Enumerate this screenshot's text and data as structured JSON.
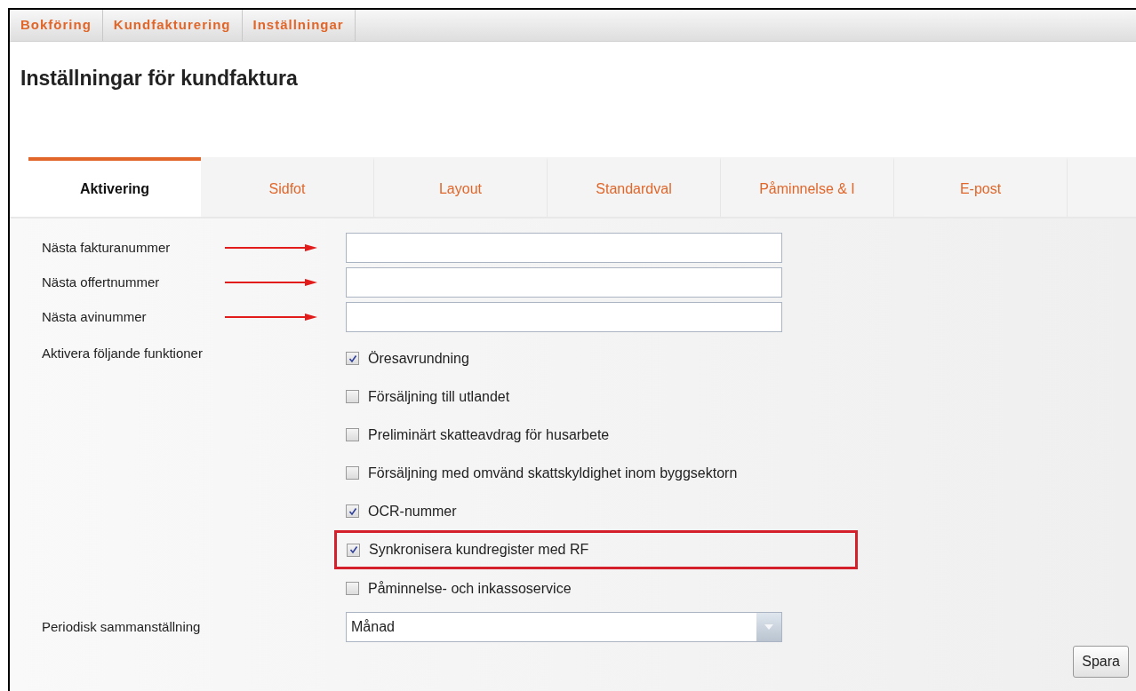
{
  "breadcrumbs": [
    "Bokföring",
    "Kundfakturering",
    "Inställningar"
  ],
  "title": "Inställningar för kundfaktura",
  "tabs": [
    {
      "label": "Aktivering",
      "selected": true
    },
    {
      "label": "Sidfot",
      "selected": false
    },
    {
      "label": "Layout",
      "selected": false
    },
    {
      "label": "Standardval",
      "selected": false
    },
    {
      "label": "Påminnelse & I",
      "selected": false
    },
    {
      "label": "E-post",
      "selected": false
    }
  ],
  "fields": [
    {
      "label": "Nästa fakturanummer",
      "arrow": true
    },
    {
      "label": "Nästa offertnummer",
      "arrow": true
    },
    {
      "label": "Nästa avinummer",
      "arrow": true
    }
  ],
  "functions": {
    "label": "Aktivera följande funktioner",
    "options": [
      {
        "label": "Öresavrundning",
        "checked": true,
        "highlighted": false
      },
      {
        "label": "Försäljning till utlandet",
        "checked": false,
        "highlighted": false
      },
      {
        "label": "Preliminärt skatteavdrag för husarbete",
        "checked": false,
        "highlighted": false
      },
      {
        "label": "Försäljning med omvänd skattskyldighet inom byggsektorn",
        "checked": false,
        "highlighted": false
      },
      {
        "label": "OCR-nummer",
        "checked": true,
        "highlighted": false
      },
      {
        "label": "Synkronisera kundregister med RF",
        "checked": true,
        "highlighted": true
      },
      {
        "label": "Påminnelse- och inkassoservice",
        "checked": false,
        "highlighted": false
      }
    ]
  },
  "period": {
    "label": "Periodisk sammanställning",
    "value": "Månad"
  },
  "save_button": "Spara"
}
